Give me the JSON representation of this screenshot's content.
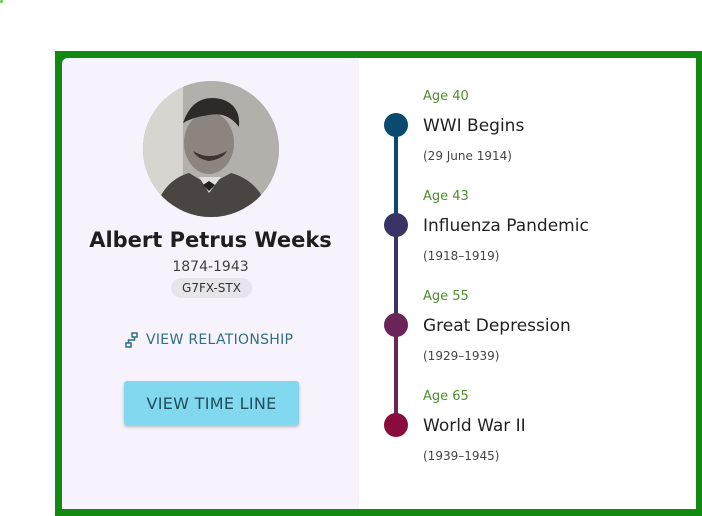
{
  "profile": {
    "name": "Albert Petrus Weeks",
    "years": "1874-1943",
    "id": "G7FX-STX",
    "relationship_label": "VIEW RELATIONSHIP",
    "timeline_button_label": "VIEW TIME LINE"
  },
  "colors": {
    "frame": "#128a12",
    "profile_bg": "#f7f3fd",
    "button_bg": "#82d9ef",
    "age_text": "#4e8d2e"
  },
  "timeline": [
    {
      "age": "Age 40",
      "event": "WWI Begins",
      "date": "(29 June 1914)",
      "color": "#0a4a6e"
    },
    {
      "age": "Age 43",
      "event": "Influenza Pandemic",
      "date": "(1918–1919)",
      "color": "#3a3466"
    },
    {
      "age": "Age 55",
      "event": "Great Depression",
      "date": "(1929–1939)",
      "color": "#6b2458"
    },
    {
      "age": "Age 65",
      "event": "World War II",
      "date": "(1939–1945)",
      "color": "#8a0c3c"
    }
  ]
}
